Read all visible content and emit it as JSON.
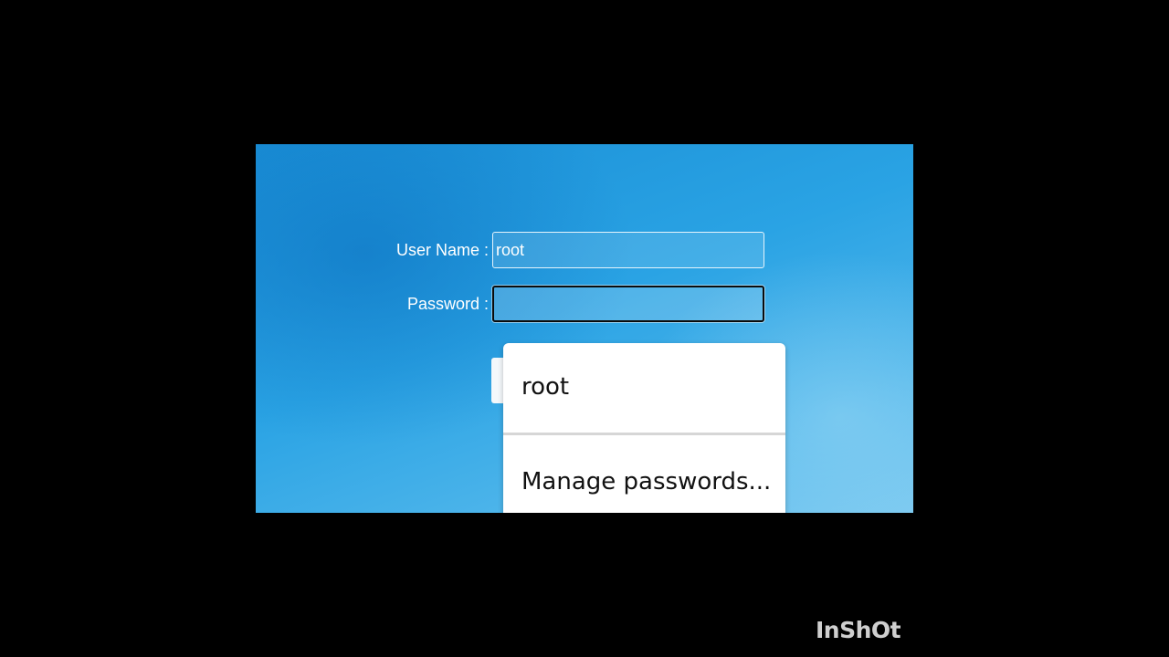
{
  "login_form": {
    "username_label": "User Name :",
    "username_value": "root",
    "password_label": "Password :",
    "password_value": ""
  },
  "autofill_popup": {
    "suggestion": "root",
    "manage_label": "Manage passwords..."
  },
  "watermark": "InShOt"
}
